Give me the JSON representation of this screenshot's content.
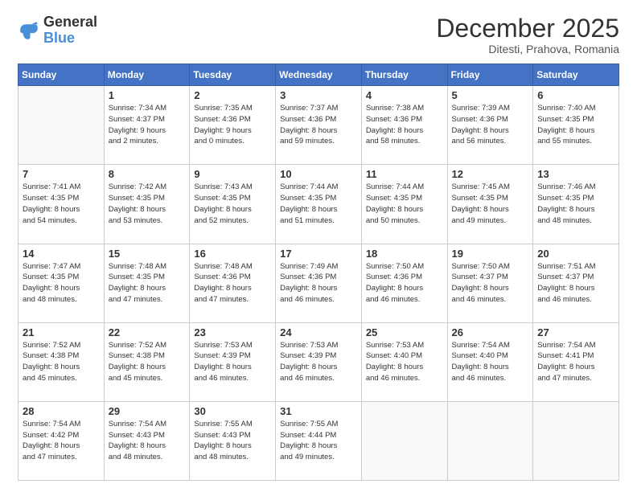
{
  "logo": {
    "line1": "General",
    "line2": "Blue"
  },
  "header": {
    "month": "December 2025",
    "location": "Ditesti, Prahova, Romania"
  },
  "weekdays": [
    "Sunday",
    "Monday",
    "Tuesday",
    "Wednesday",
    "Thursday",
    "Friday",
    "Saturday"
  ],
  "weeks": [
    [
      {
        "day": "",
        "info": ""
      },
      {
        "day": "1",
        "info": "Sunrise: 7:34 AM\nSunset: 4:37 PM\nDaylight: 9 hours\nand 2 minutes."
      },
      {
        "day": "2",
        "info": "Sunrise: 7:35 AM\nSunset: 4:36 PM\nDaylight: 9 hours\nand 0 minutes."
      },
      {
        "day": "3",
        "info": "Sunrise: 7:37 AM\nSunset: 4:36 PM\nDaylight: 8 hours\nand 59 minutes."
      },
      {
        "day": "4",
        "info": "Sunrise: 7:38 AM\nSunset: 4:36 PM\nDaylight: 8 hours\nand 58 minutes."
      },
      {
        "day": "5",
        "info": "Sunrise: 7:39 AM\nSunset: 4:36 PM\nDaylight: 8 hours\nand 56 minutes."
      },
      {
        "day": "6",
        "info": "Sunrise: 7:40 AM\nSunset: 4:35 PM\nDaylight: 8 hours\nand 55 minutes."
      }
    ],
    [
      {
        "day": "7",
        "info": "Sunrise: 7:41 AM\nSunset: 4:35 PM\nDaylight: 8 hours\nand 54 minutes."
      },
      {
        "day": "8",
        "info": "Sunrise: 7:42 AM\nSunset: 4:35 PM\nDaylight: 8 hours\nand 53 minutes."
      },
      {
        "day": "9",
        "info": "Sunrise: 7:43 AM\nSunset: 4:35 PM\nDaylight: 8 hours\nand 52 minutes."
      },
      {
        "day": "10",
        "info": "Sunrise: 7:44 AM\nSunset: 4:35 PM\nDaylight: 8 hours\nand 51 minutes."
      },
      {
        "day": "11",
        "info": "Sunrise: 7:44 AM\nSunset: 4:35 PM\nDaylight: 8 hours\nand 50 minutes."
      },
      {
        "day": "12",
        "info": "Sunrise: 7:45 AM\nSunset: 4:35 PM\nDaylight: 8 hours\nand 49 minutes."
      },
      {
        "day": "13",
        "info": "Sunrise: 7:46 AM\nSunset: 4:35 PM\nDaylight: 8 hours\nand 48 minutes."
      }
    ],
    [
      {
        "day": "14",
        "info": "Sunrise: 7:47 AM\nSunset: 4:35 PM\nDaylight: 8 hours\nand 48 minutes."
      },
      {
        "day": "15",
        "info": "Sunrise: 7:48 AM\nSunset: 4:35 PM\nDaylight: 8 hours\nand 47 minutes."
      },
      {
        "day": "16",
        "info": "Sunrise: 7:48 AM\nSunset: 4:36 PM\nDaylight: 8 hours\nand 47 minutes."
      },
      {
        "day": "17",
        "info": "Sunrise: 7:49 AM\nSunset: 4:36 PM\nDaylight: 8 hours\nand 46 minutes."
      },
      {
        "day": "18",
        "info": "Sunrise: 7:50 AM\nSunset: 4:36 PM\nDaylight: 8 hours\nand 46 minutes."
      },
      {
        "day": "19",
        "info": "Sunrise: 7:50 AM\nSunset: 4:37 PM\nDaylight: 8 hours\nand 46 minutes."
      },
      {
        "day": "20",
        "info": "Sunrise: 7:51 AM\nSunset: 4:37 PM\nDaylight: 8 hours\nand 46 minutes."
      }
    ],
    [
      {
        "day": "21",
        "info": "Sunrise: 7:52 AM\nSunset: 4:38 PM\nDaylight: 8 hours\nand 45 minutes."
      },
      {
        "day": "22",
        "info": "Sunrise: 7:52 AM\nSunset: 4:38 PM\nDaylight: 8 hours\nand 45 minutes."
      },
      {
        "day": "23",
        "info": "Sunrise: 7:53 AM\nSunset: 4:39 PM\nDaylight: 8 hours\nand 46 minutes."
      },
      {
        "day": "24",
        "info": "Sunrise: 7:53 AM\nSunset: 4:39 PM\nDaylight: 8 hours\nand 46 minutes."
      },
      {
        "day": "25",
        "info": "Sunrise: 7:53 AM\nSunset: 4:40 PM\nDaylight: 8 hours\nand 46 minutes."
      },
      {
        "day": "26",
        "info": "Sunrise: 7:54 AM\nSunset: 4:40 PM\nDaylight: 8 hours\nand 46 minutes."
      },
      {
        "day": "27",
        "info": "Sunrise: 7:54 AM\nSunset: 4:41 PM\nDaylight: 8 hours\nand 47 minutes."
      }
    ],
    [
      {
        "day": "28",
        "info": "Sunrise: 7:54 AM\nSunset: 4:42 PM\nDaylight: 8 hours\nand 47 minutes."
      },
      {
        "day": "29",
        "info": "Sunrise: 7:54 AM\nSunset: 4:43 PM\nDaylight: 8 hours\nand 48 minutes."
      },
      {
        "day": "30",
        "info": "Sunrise: 7:55 AM\nSunset: 4:43 PM\nDaylight: 8 hours\nand 48 minutes."
      },
      {
        "day": "31",
        "info": "Sunrise: 7:55 AM\nSunset: 4:44 PM\nDaylight: 8 hours\nand 49 minutes."
      },
      {
        "day": "",
        "info": ""
      },
      {
        "day": "",
        "info": ""
      },
      {
        "day": "",
        "info": ""
      }
    ]
  ]
}
